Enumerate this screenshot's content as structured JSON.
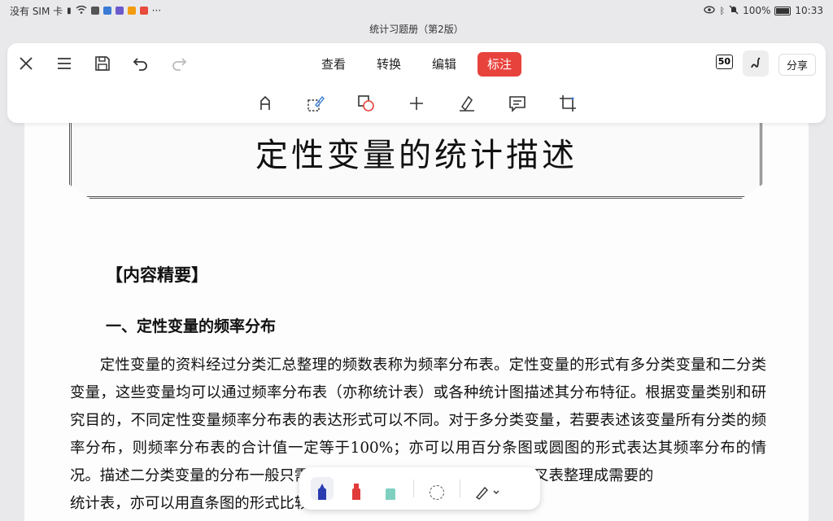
{
  "status": {
    "carrier": "没有 SIM 卡",
    "battery": "100%",
    "time": "10:33"
  },
  "document": {
    "title": "统计习题册（第2版）"
  },
  "toolbar": {
    "tabs": [
      {
        "label": "查看"
      },
      {
        "label": "转换"
      },
      {
        "label": "编辑"
      },
      {
        "label": "标注"
      }
    ],
    "active_tab": "标注",
    "badge": "50",
    "share_label": "分享"
  },
  "page": {
    "chapter_title": "定性变量的统计描述",
    "section_heading": "【内容精要】",
    "subsection_heading": "一、定性变量的频率分布",
    "paragraph": "定性变量的资料经过分类汇总整理的频数表称为频率分布表。定性变量的形式有多分类变量和二分类变量，这些变量均可以通过频率分布表（亦称统计表）或各种统计图描述其分布特征。根据变量类别和研究目的，不同定性变量频率分布表的表达形式可以不同。对于多分类变量，若要表述该变量所有分类的频率分布，则频率分布表的合计值一定等于100%；亦可以用百分条图或圆图的形式表达其频率分布的情况。描述二分类变量的分布一般只需计算一个频率，通常用",
    "paragraph_tail": "，可以从交叉表整理成需要的",
    "last_line": "统计表，亦可以用直条图的形式比较其频率分布。"
  },
  "colors": {
    "accent": "#e8423d",
    "pen_blue": "#2a3bb0",
    "pen_red": "#e03a3a",
    "highlighter": "#7fd0c0"
  }
}
